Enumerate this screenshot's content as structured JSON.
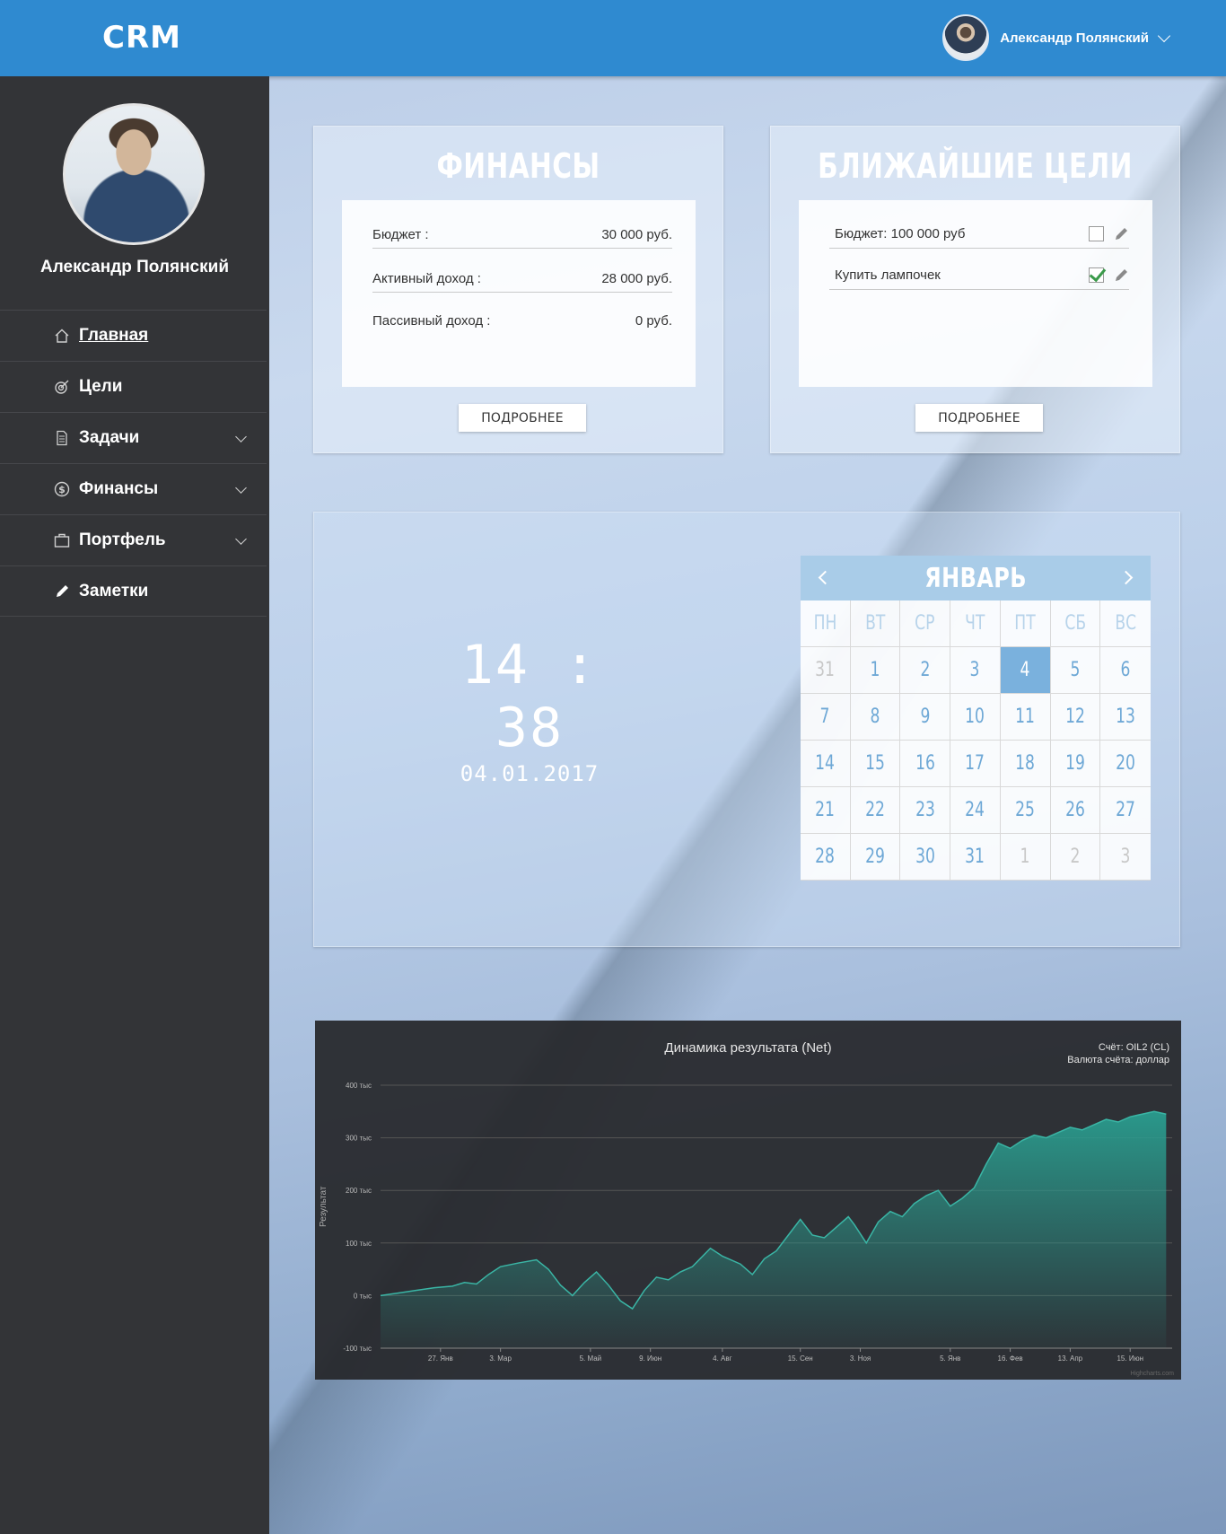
{
  "header": {
    "logo": "CRM",
    "user_name": "Александр Полянский"
  },
  "sidebar": {
    "user_name": "Александр Полянский",
    "items": [
      {
        "label": "Главная",
        "icon": "home-icon",
        "active": true,
        "has_submenu": false
      },
      {
        "label": "Цели",
        "icon": "target-icon",
        "active": false,
        "has_submenu": false
      },
      {
        "label": "Задачи",
        "icon": "document-icon",
        "active": false,
        "has_submenu": true
      },
      {
        "label": "Финансы",
        "icon": "dollar-icon",
        "active": false,
        "has_submenu": true
      },
      {
        "label": "Портфель",
        "icon": "briefcase-icon",
        "active": false,
        "has_submenu": true
      },
      {
        "label": "Заметки",
        "icon": "pencil-icon",
        "active": false,
        "has_submenu": false
      }
    ]
  },
  "finance": {
    "title": "ФИНАНСЫ",
    "rows": [
      {
        "label": "Бюджет   :",
        "value": "30 000 руб."
      },
      {
        "label": "Активный доход   :",
        "value": "28 000 руб."
      },
      {
        "label": "Пассивный доход   :",
        "value": "0 руб."
      }
    ],
    "button": "ПОДРОБНЕЕ"
  },
  "goals": {
    "title": "БЛИЖАЙШИЕ ЦЕЛИ",
    "items": [
      {
        "text": "Бюджет: 100 000 руб",
        "checked": false
      },
      {
        "text": "Купить лампочек",
        "checked": true
      }
    ],
    "button": "ПОДРОБНЕЕ"
  },
  "clock": {
    "time": "14 : 38",
    "date": "04.01.2017"
  },
  "calendar": {
    "month": "ЯНВАРЬ",
    "weekdays": [
      "ПН",
      "ВТ",
      "СР",
      "ЧТ",
      "ПТ",
      "СБ",
      "ВС"
    ],
    "days": [
      {
        "d": "31",
        "muted": true
      },
      {
        "d": "1"
      },
      {
        "d": "2"
      },
      {
        "d": "3"
      },
      {
        "d": "4",
        "today": true
      },
      {
        "d": "5"
      },
      {
        "d": "6"
      },
      {
        "d": "7"
      },
      {
        "d": "8"
      },
      {
        "d": "9"
      },
      {
        "d": "10"
      },
      {
        "d": "11"
      },
      {
        "d": "12"
      },
      {
        "d": "13"
      },
      {
        "d": "14"
      },
      {
        "d": "15"
      },
      {
        "d": "16"
      },
      {
        "d": "17"
      },
      {
        "d": "18"
      },
      {
        "d": "19"
      },
      {
        "d": "20"
      },
      {
        "d": "21"
      },
      {
        "d": "22"
      },
      {
        "d": "23"
      },
      {
        "d": "24"
      },
      {
        "d": "25"
      },
      {
        "d": "26"
      },
      {
        "d": "27"
      },
      {
        "d": "28"
      },
      {
        "d": "29"
      },
      {
        "d": "30"
      },
      {
        "d": "31"
      },
      {
        "d": "1",
        "muted": true
      },
      {
        "d": "2",
        "muted": true
      },
      {
        "d": "3",
        "muted": true
      }
    ]
  },
  "chart": {
    "account": "Счёт: OIL2 (CL)",
    "currency": "Валюта счёта: доллар",
    "credits": "Highcharts.com"
  },
  "chart_data": {
    "type": "area",
    "title": "Динамика результата (Net)",
    "ylabel": "Результат",
    "y_ticks": [
      "400 тыс",
      "300 тыс",
      "200 тыс",
      "100 тыс",
      "0 тыс",
      "-100 тыс"
    ],
    "ylim": [
      -100000,
      400000
    ],
    "x_ticks": [
      "27. Янв",
      "3. Мар",
      "5. Май",
      "9. Июн",
      "4. Авг",
      "15. Сен",
      "3. Ноя",
      "5. Янв",
      "16. Фев",
      "13. Апр",
      "15. Июн"
    ],
    "x_tick_pos": [
      1,
      2,
      3.5,
      4.5,
      5.7,
      7.0,
      8.0,
      9.5,
      10.5,
      11.5,
      12.5
    ],
    "xlim": [
      0,
      13.2
    ],
    "series": [
      {
        "x": [
          0,
          0.3,
          0.6,
          0.9,
          1.2,
          1.4,
          1.6,
          1.8,
          2.0,
          2.3,
          2.6,
          2.8,
          3.0,
          3.2,
          3.4,
          3.6,
          3.8,
          4.0,
          4.2,
          4.4,
          4.6,
          4.8,
          5.0,
          5.2,
          5.5,
          5.7,
          6.0,
          6.2,
          6.4,
          6.6,
          6.8,
          7.0,
          7.2,
          7.4,
          7.6,
          7.8,
          7.9,
          8.1,
          8.3,
          8.5,
          8.7,
          8.9,
          9.1,
          9.3,
          9.5,
          9.7,
          9.9,
          10.1,
          10.3,
          10.5,
          10.7,
          10.9,
          11.1,
          11.3,
          11.5,
          11.7,
          11.9,
          12.1,
          12.3,
          12.5,
          12.7,
          12.9,
          13.1
        ],
        "y": [
          0,
          5000,
          10000,
          15000,
          18000,
          25000,
          22000,
          40000,
          55000,
          62000,
          68000,
          50000,
          20000,
          0,
          25000,
          45000,
          20000,
          -10000,
          -25000,
          10000,
          35000,
          30000,
          45000,
          55000,
          90000,
          75000,
          60000,
          40000,
          70000,
          85000,
          115000,
          145000,
          115000,
          110000,
          130000,
          150000,
          135000,
          100000,
          140000,
          160000,
          150000,
          175000,
          190000,
          200000,
          170000,
          185000,
          205000,
          250000,
          290000,
          280000,
          295000,
          305000,
          300000,
          310000,
          320000,
          315000,
          325000,
          335000,
          330000,
          340000,
          345000,
          350000,
          345000
        ]
      }
    ]
  },
  "colors": {
    "header": "#2f8ad0",
    "sidebar": "#333437",
    "area_fill": "#2a9d8f",
    "today": "#7ab1dd"
  }
}
